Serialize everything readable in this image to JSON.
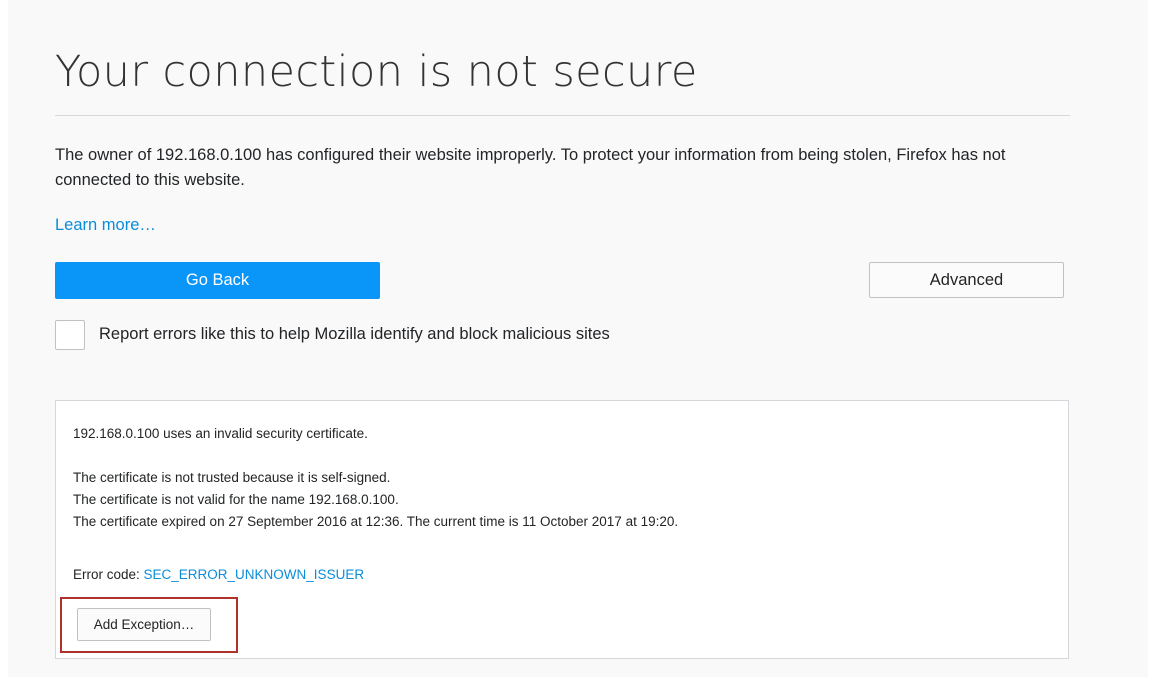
{
  "page": {
    "title": "Your connection is not secure",
    "description": "The owner of 192.168.0.100 has configured their website improperly. To protect your information from being stolen, Firefox has not connected to this website.",
    "learn_more": "Learn more…"
  },
  "buttons": {
    "go_back": "Go Back",
    "advanced": "Advanced",
    "add_exception": "Add Exception…"
  },
  "report": {
    "checked": false,
    "label": "Report errors like this to help Mozilla identify and block malicious sites"
  },
  "details": {
    "summary": "192.168.0.100 uses an invalid security certificate.",
    "lines": [
      "The certificate is not trusted because it is self-signed.",
      "The certificate is not valid for the name 192.168.0.100.",
      "The certificate expired on 27 September 2016 at 12:36. The current time is 11 October 2017 at 19:20."
    ],
    "error_code_label": "Error code: ",
    "error_code": "SEC_ERROR_UNKNOWN_ISSUER"
  },
  "colors": {
    "accent": "#0996f8",
    "link": "#0a8dd9",
    "highlight": "#b0302a"
  }
}
